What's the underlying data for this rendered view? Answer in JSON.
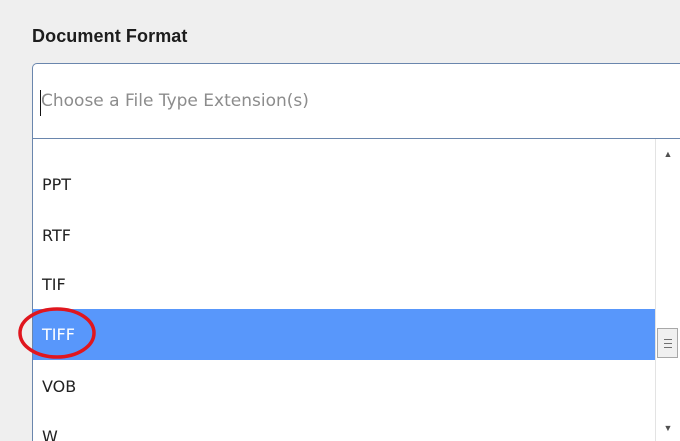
{
  "document_format": {
    "title": "Document Format",
    "input": {
      "value": "",
      "placeholder": "Choose a File Type Extension(s)"
    },
    "options": [
      {
        "label": "PPT",
        "selected": false
      },
      {
        "label": "RTF",
        "selected": false
      },
      {
        "label": "TIF",
        "selected": false
      },
      {
        "label": "TIFF",
        "selected": true
      },
      {
        "label": "VOB",
        "selected": false
      },
      {
        "label": "W",
        "selected": false
      }
    ]
  },
  "scrollbar": {
    "up_arrow_icon": "triangle-up-icon",
    "down_arrow_icon": "triangle-down-icon"
  },
  "annotation": {
    "shape": "ellipse",
    "color": "#e0161e",
    "target": "TIFF"
  },
  "colors": {
    "selected_background": "#5897fb",
    "input_border": "#6a86ad",
    "panel_background": "#efefef"
  }
}
